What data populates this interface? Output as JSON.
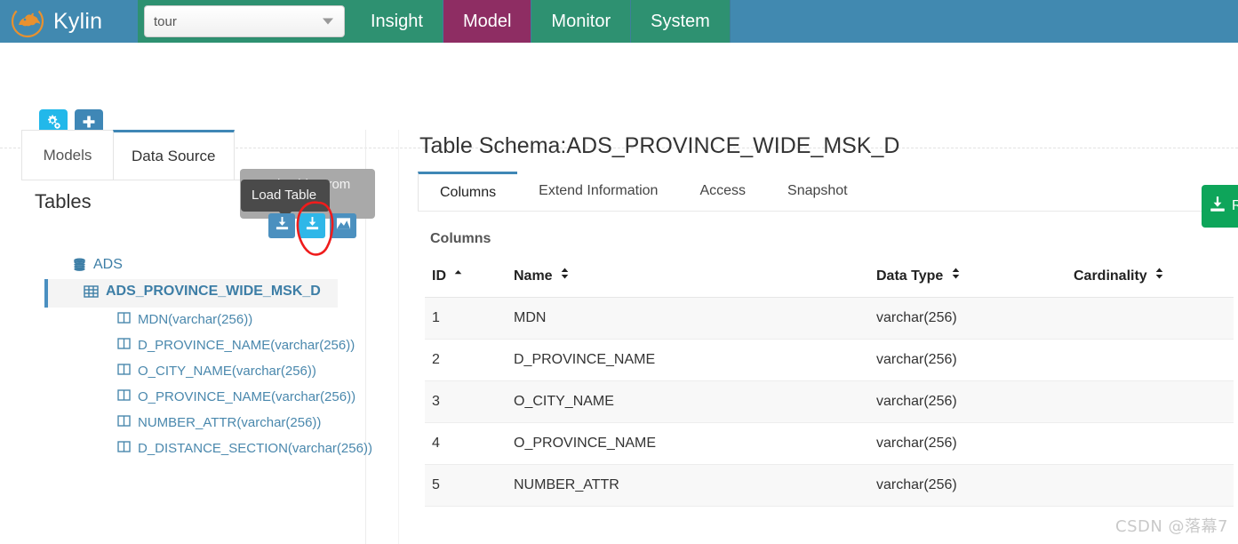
{
  "navbar": {
    "brand": "Kylin",
    "brand_logo_icon": "kylin-logo-icon",
    "project_select": {
      "value": "tour",
      "caret_icon": "chevron-down-icon"
    },
    "items": [
      {
        "label": "Insight",
        "active": false
      },
      {
        "label": "Model",
        "active": true
      },
      {
        "label": "Monitor",
        "active": false
      },
      {
        "label": "System",
        "active": false
      }
    ],
    "colors": {
      "bar": "#4189b0",
      "item": "#2e9171",
      "active": "#8e2d63"
    }
  },
  "toolbar": {
    "settings_icon": "cogs-icon",
    "add_icon": "plus-icon",
    "colors": {
      "settings": "#22b8ea",
      "add": "#3f87b6"
    }
  },
  "left_panel": {
    "tabs": [
      {
        "label": "Models",
        "active": false
      },
      {
        "label": "Data Source",
        "active": true
      }
    ],
    "section_title": "Tables",
    "actions": [
      {
        "icon": "load-table-download-icon",
        "highlighted": false
      },
      {
        "icon": "load-table-from-tree-download-icon",
        "highlighted": true
      },
      {
        "icon": "load-table-chart-icon",
        "highlighted": false
      }
    ],
    "tooltips": [
      {
        "text": "Load Table From Tree",
        "style": "back"
      },
      {
        "text": "Load Table",
        "style": "front"
      }
    ],
    "tree": [
      {
        "level": 0,
        "icon": "database-icon",
        "label": "ADS",
        "selected": false
      },
      {
        "level": 1,
        "icon": "table-icon",
        "label": "ADS_PROVINCE_WIDE_MSK_D",
        "selected": true
      },
      {
        "level": 2,
        "icon": "column-icon",
        "label": "MDN(varchar(256))",
        "selected": false
      },
      {
        "level": 2,
        "icon": "column-icon",
        "label": "D_PROVINCE_NAME(varchar(256))",
        "selected": false
      },
      {
        "level": 2,
        "icon": "column-icon",
        "label": "O_CITY_NAME(varchar(256))",
        "selected": false
      },
      {
        "level": 2,
        "icon": "column-icon",
        "label": "O_PROVINCE_NAME(varchar(256))",
        "selected": false
      },
      {
        "level": 2,
        "icon": "column-icon",
        "label": "NUMBER_ATTR(varchar(256))",
        "selected": false
      },
      {
        "level": 2,
        "icon": "column-icon",
        "label": "D_DISTANCE_SECTION(varchar(256))",
        "selected": false
      }
    ]
  },
  "main": {
    "title": "Table Schema:ADS_PROVINCE_WIDE_MSK_D",
    "tabs": [
      {
        "label": "Columns",
        "active": true
      },
      {
        "label": "Extend Information",
        "active": false
      },
      {
        "label": "Access",
        "active": false
      },
      {
        "label": "Snapshot",
        "active": false
      }
    ],
    "section_title": "Columns",
    "reload_button": {
      "label": "R",
      "icon": "download-icon",
      "color": "#0ea55a"
    },
    "table": {
      "headers": [
        {
          "label": "ID",
          "sort": "asc"
        },
        {
          "label": "Name",
          "sort": "both"
        },
        {
          "label": "Data Type",
          "sort": "both"
        },
        {
          "label": "Cardinality",
          "sort": "both"
        }
      ],
      "rows": [
        {
          "id": "1",
          "name": "MDN",
          "data_type": "varchar(256)",
          "cardinality": ""
        },
        {
          "id": "2",
          "name": "D_PROVINCE_NAME",
          "data_type": "varchar(256)",
          "cardinality": ""
        },
        {
          "id": "3",
          "name": "O_CITY_NAME",
          "data_type": "varchar(256)",
          "cardinality": ""
        },
        {
          "id": "4",
          "name": "O_PROVINCE_NAME",
          "data_type": "varchar(256)",
          "cardinality": ""
        },
        {
          "id": "5",
          "name": "NUMBER_ATTR",
          "data_type": "varchar(256)",
          "cardinality": ""
        }
      ]
    }
  },
  "annotations": {
    "red_circle_icon": "hand-drawn-red-ellipse",
    "watermark": "CSDN @落幕7"
  }
}
